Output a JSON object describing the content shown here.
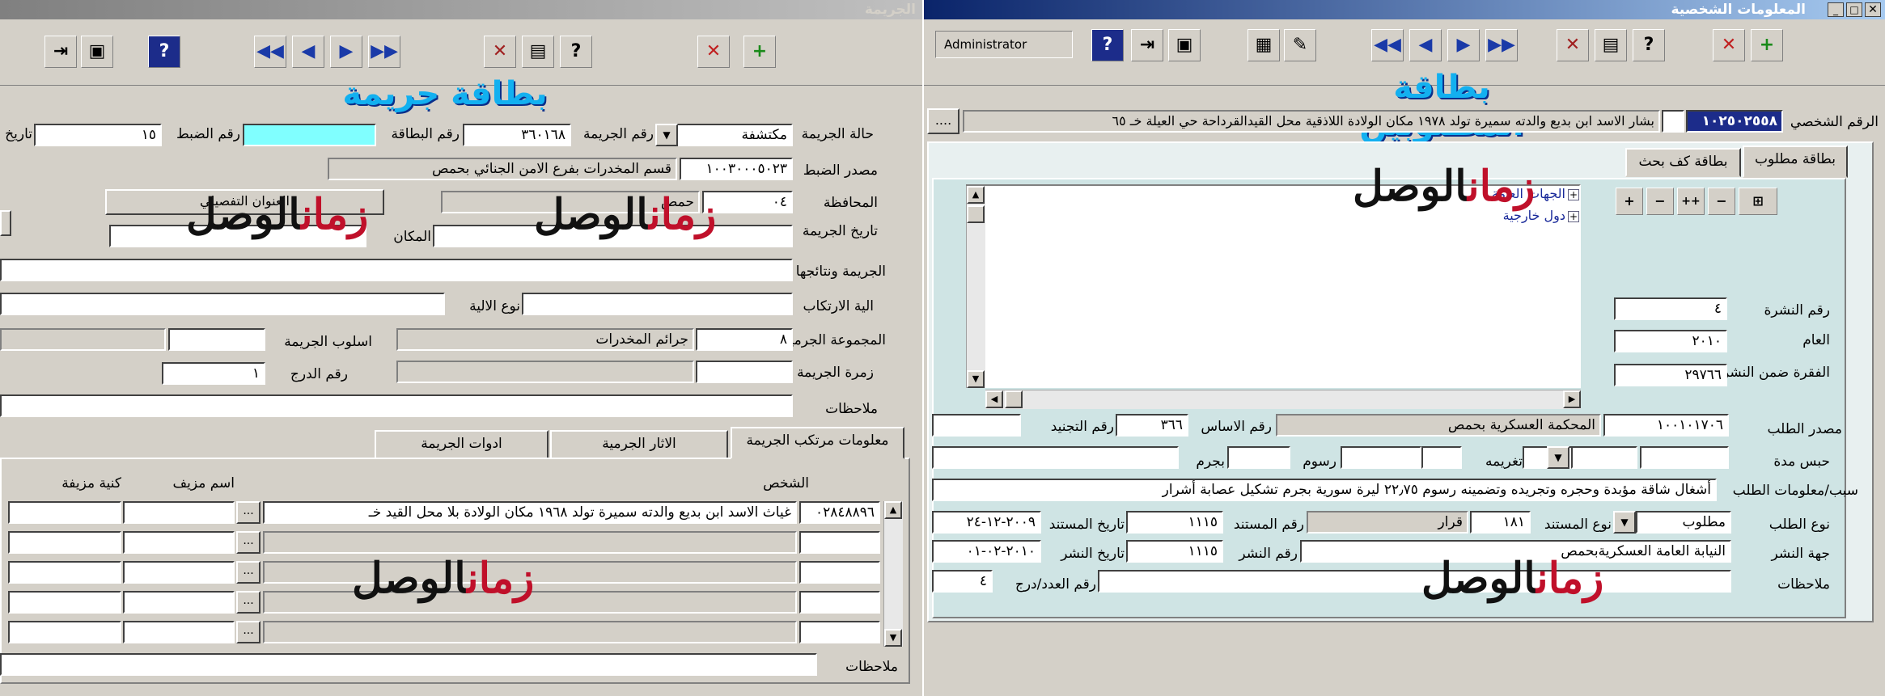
{
  "left_window": {
    "title": "الجريمة",
    "card_title": "بطاقة جريمة",
    "fields": {
      "case_status_label": "حالة الجريمة",
      "case_status_value": "مكتشفة",
      "crime_no_label": "رقم الجريمة",
      "crime_no_value": "٣٦٠١٦٨",
      "card_no_label": "رقم البطاقة",
      "card_no_value": "",
      "seizure_no_label": "رقم الضبط",
      "seizure_no_value": "١٥",
      "date_label": "تاريخ",
      "source_label": "مصدر الضبط",
      "source_code": "١٠٠٣٠٠٠٥٠٢٣",
      "source_value": "قسم المخدرات بفرع الامن الجنائي بحمص",
      "gov_label": "المحافظة",
      "gov_code": "٠٤",
      "gov_value": "حمص",
      "crime_date_label": "تاريخ الجريمة",
      "place_label": "المكان",
      "detail_address_label": "العنوان التفصيلي",
      "crime_results_label": "الجريمة ونتائجها",
      "method_label": "الية الارتكاب",
      "tool_type_label": "نوع الالية",
      "group_label": "المجموعة الجرمية",
      "group_code": "٨",
      "group_value": "جرائم المخدرات",
      "style_label": "اسلوب الجريمة",
      "crime_class_label": "زمرة الجريمة",
      "rank_label": "رقم الدرج",
      "rank_value": "١",
      "notes_label": "ملاحظات"
    },
    "tabs": [
      "معلومات مرتكب الجريمة",
      "الاثار الجرمية",
      "ادوات الجريمة"
    ],
    "grid_headers": {
      "person": "الشخص",
      "fake_name": "اسم مزيف",
      "fake_nick": "كنية مزيفة"
    },
    "grid_rows": [
      {
        "id": "٠٢٨٤٨٨٩٦",
        "person": "غياث  الاسد ابن بديع والدته سميرة تولد  ١٩٦٨ مكان الولادة  بلا محل القيد خـ"
      },
      {
        "id": "",
        "person": ""
      },
      {
        "id": "",
        "person": ""
      },
      {
        "id": "",
        "person": ""
      },
      {
        "id": "",
        "person": ""
      }
    ],
    "bottom_notes_label": "ملاحظات"
  },
  "right_window": {
    "title": "المعلومات الشخصية",
    "user": "Administrator",
    "card_title": "بطاقة المطلوبين",
    "personal_no_label": "الرقم الشخصي",
    "personal_no_value": "١٠٢٥٠٢٥٥٨",
    "personal_info": "بشار  الاسد ابن بديع والدته سميرة تولد  ١٩٧٨ مكان الولادة  اللاذقية محل القيدالقرداحة حي العيلة خـ ٦٥",
    "more_button": "....",
    "tabs": [
      "بطاقة مطلوب",
      "بطاقة كف بحث"
    ],
    "tree_items": [
      "الجهات العامة",
      "دول خارجية"
    ],
    "bulletin_no_label": "رقم النشرة",
    "bulletin_no_value": "٤",
    "year_label": "العام",
    "year_value": "٢٠١٠",
    "paragraph_label": "الفقرة ضمن النشرة",
    "paragraph_value": "٢٩٧٦٦",
    "request_source_label": "مصدر الطلب",
    "request_source_code": "١٠٠١٠١٧٠٦",
    "request_source_value": "المحكمة العسكرية بحمص",
    "base_no_label": "رقم الاساس",
    "base_no_value": "٣٦٦",
    "recruit_no_label": "رقم التجنيد",
    "prison_label": "حبس مدة",
    "fine_label": "تغريمه",
    "fees_label": "رسوم",
    "crime_label": "بجرم",
    "reason_label": "سبب/معلومات الطلب",
    "reason_value": "أشغال شاقة مؤبدة وحجره وتجريده وتضمينه رسوم ٢٢٫٧٥ ليرة سورية بجرم تشكيل عصابة أشرار",
    "request_type_label": "نوع الطلب",
    "request_type_value": "مطلوب",
    "doc_type_label": "نوع المستند",
    "doc_type_code": "١٨١",
    "doc_type_value": "قرار",
    "doc_no_label": "رقم المستند",
    "doc_no_value": "١١١٥",
    "doc_date_label": "تاريخ المستند",
    "doc_date_value": "٢٠٠٩-١٢-٢٤",
    "pub_party_label": "جهة النشر",
    "pub_party_value": "النيابة العامة العسكريةبحمص",
    "pub_no_label": "رقم النشر",
    "pub_no_value": "١١١٥",
    "pub_date_label": "تاريخ النشر",
    "pub_date_value": "٢٠١٠-٠٢-٠١",
    "notes_label": "ملاحظات",
    "issue_label": "رقم العدد/درج",
    "issue_value": "٤"
  },
  "watermark": {
    "red": "زمان",
    "black": "الوصل"
  }
}
